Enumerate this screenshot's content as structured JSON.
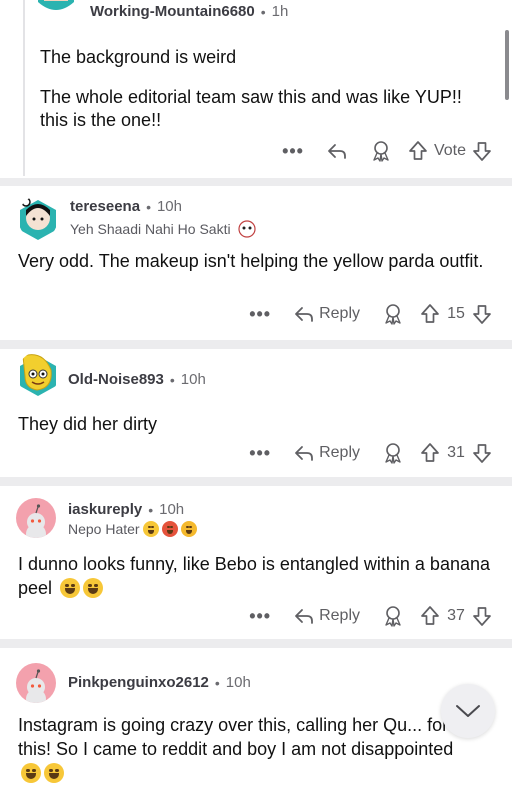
{
  "comments": [
    {
      "username": "Working-Mountain6680",
      "time": "1h",
      "paragraphs": [
        "The background is weird",
        "The whole editorial team saw this and was like YUP!! this is the one!!"
      ],
      "vote_label": "Vote"
    },
    {
      "username": "tereseena",
      "time": "10h",
      "flair": "Yeh Shaadi Nahi Ho Sakti",
      "text": "Very odd. The makeup isn't helping the yellow parda outfit.",
      "reply_label": "Reply",
      "votes": "15"
    },
    {
      "username": "Old-Noise893",
      "time": "10h",
      "text": "They did her dirty",
      "reply_label": "Reply",
      "votes": "31"
    },
    {
      "username": "iaskureply",
      "time": "10h",
      "flair": "Nepo Hater",
      "text": "I dunno looks funny, like Bebo is entangled within a banana peel",
      "reply_label": "Reply",
      "votes": "37"
    },
    {
      "username": "Pinkpenguinxo2612",
      "time": "10h",
      "text": "Instagram is going crazy over this, calling her Qu... for this! So I came to reddit and boy I am not disappointed"
    }
  ],
  "more_glyph": "•••",
  "separator": "•",
  "colors": {
    "background": "#ececee",
    "card": "#ffffff",
    "meta_text": "#6b6b70",
    "action_icon": "#5f5f63"
  }
}
